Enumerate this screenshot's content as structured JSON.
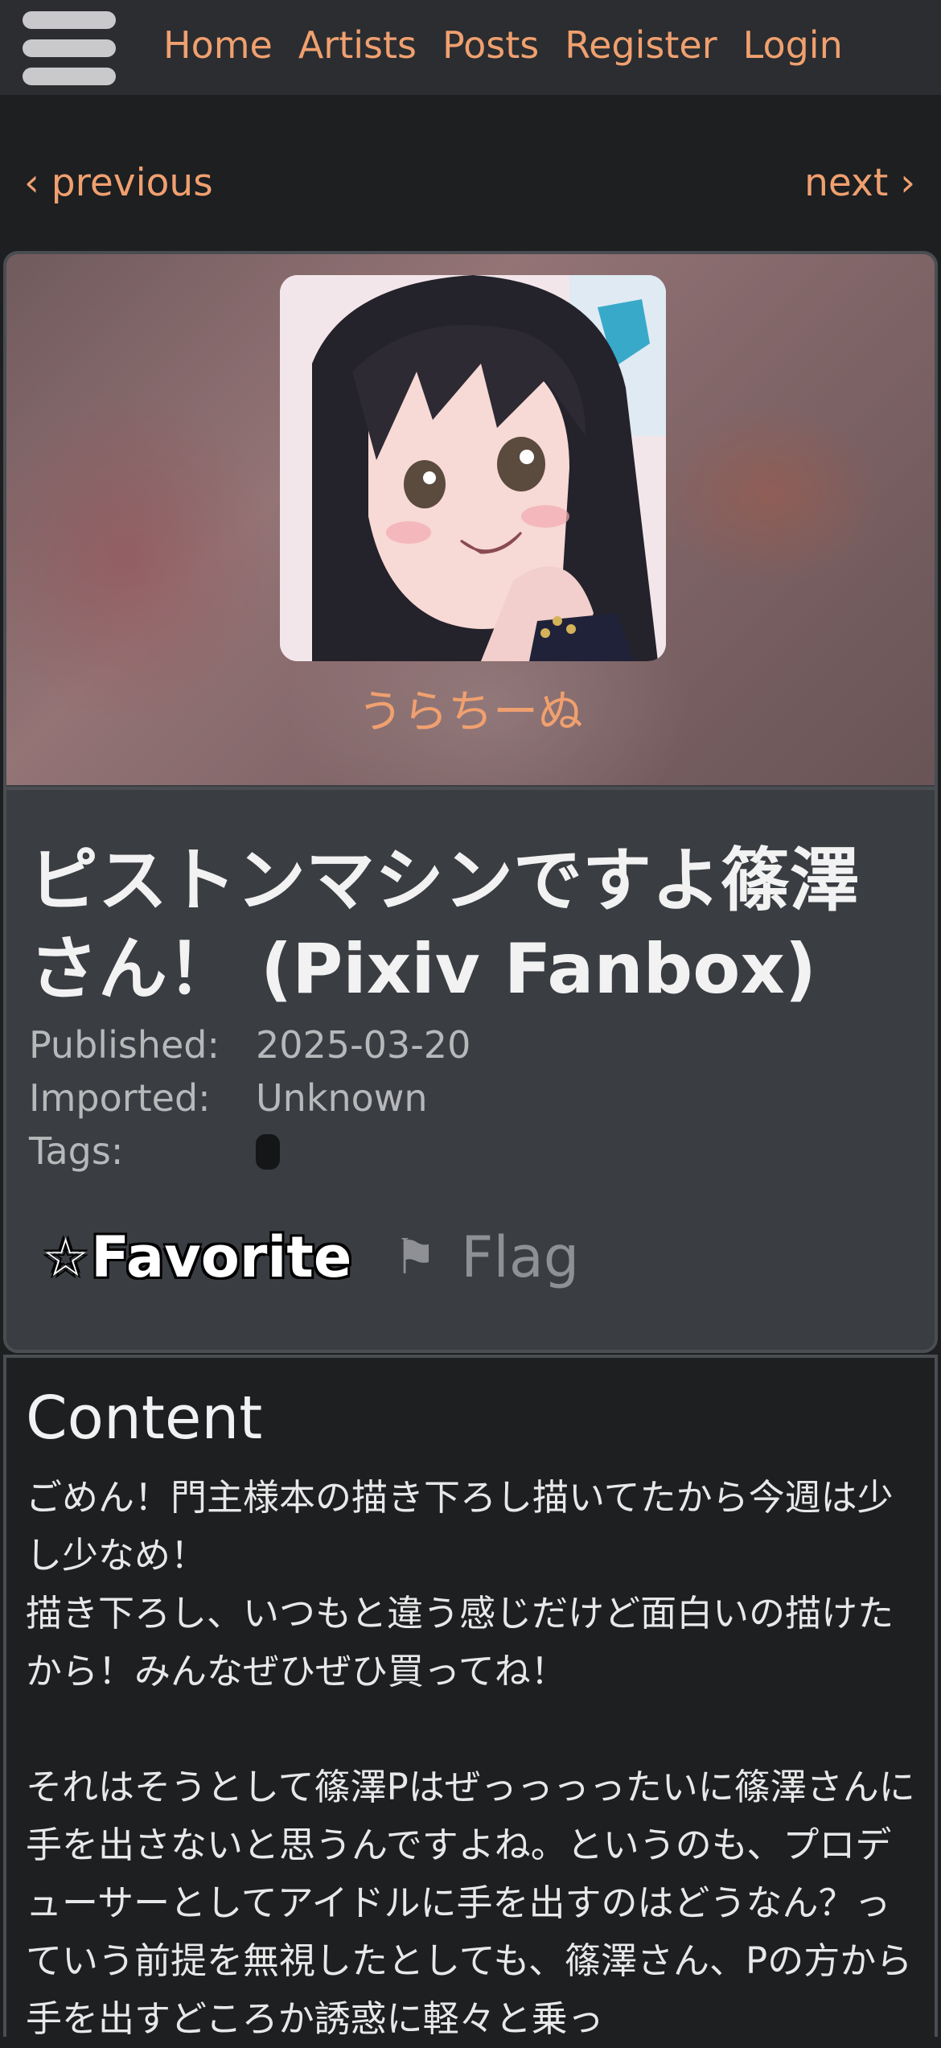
{
  "nav": {
    "menu_icon": "hamburger-icon",
    "links": [
      "Home",
      "Artists",
      "Posts",
      "Register",
      "Login"
    ]
  },
  "pager": {
    "previous": "‹ previous",
    "next": "next ›"
  },
  "artist": {
    "name": "うらちーぬ"
  },
  "post": {
    "title": "ピストンマシンですよ篠澤さん！ (Pixiv Fanbox)",
    "meta": {
      "published_label": "Published:",
      "published_value": "2025-03-20",
      "imported_label": "Imported:",
      "imported_value": "Unknown",
      "tags_label": "Tags:"
    },
    "favorite_icon": "☆",
    "favorite_label": "Favorite",
    "flag_icon": "⚑",
    "flag_label": "Flag"
  },
  "content": {
    "heading": "Content",
    "body": "ごめん！門主様本の描き下ろし描いてたから今週は少し少なめ！\n描き下ろし、いつもと違う感じだけど面白いの描けたから！みんなぜひぜひ買ってね！\n\nそれはそうとして篠澤Pはぜっっっったいに篠澤さんに手を出さないと思うんですよね。というのも、プロデューサーとしてアイドルに手を出すのはどうなん？っていう前提を無視したとしても、篠澤さん、Pの方から手を出すどころか誘惑に軽々と乗っ"
  },
  "colors": {
    "accent": "#f0a06f",
    "background": "#1d1f21",
    "nav_bg": "#2b2d30",
    "card_bg": "#3a3d42"
  }
}
